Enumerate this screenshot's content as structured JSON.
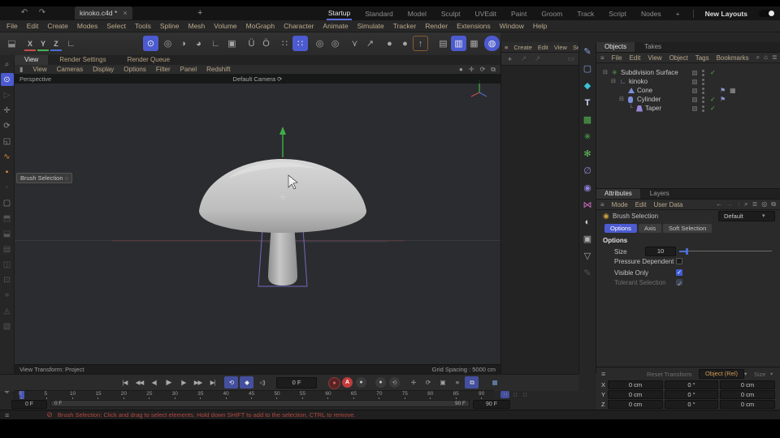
{
  "icons": {
    "undo": "↶",
    "redo": "↷",
    "close": "×",
    "plus": "+",
    "hamburger": "≡",
    "search": "⌕",
    "home": "⌂",
    "filter": "≣",
    "export": "⧉",
    "badge": "◎",
    "arrow_left": "←",
    "arrow_right": "→",
    "arrow_up": "↑",
    "chevron_down": "▾",
    "chevron_right": "›",
    "check": "✓",
    "flag": "⚑",
    "checker": "▦",
    "loop": "⟲",
    "keyframe": "◆",
    "speaker": "◁)",
    "record": "●",
    "autokey": "A",
    "move": "✛",
    "rotate": "⟳",
    "scale": "◱",
    "magnify": "⌕",
    "live_select": "⊙",
    "play_dim": "▷",
    "point": "∿",
    "edge": "▪",
    "polygon": "▫",
    "model": "▢",
    "gem": "◈",
    "snap": "Ü",
    "quantize": "Ö",
    "grid": "∷",
    "target": "◎",
    "bird": "⋎",
    "arrow_ne": "↗",
    "circle": "●",
    "axis_up": "↑",
    "corner": "∟",
    "pen": "✎",
    "square": "▢",
    "cube": "◆",
    "text_t": "T",
    "subd": "▩",
    "clover": "✳",
    "flower": "✻",
    "field": "∅",
    "mograph": "◉",
    "volume": "⋈",
    "env": "◐",
    "camera": "▣",
    "light": "▽",
    "trash": "▭",
    "chart": "▦",
    "bar": "▮",
    "dot_tool": "◌",
    "refresh": "⟳"
  },
  "titlebar": {
    "document_tab": "kinoko.c4d *",
    "layout_tabs": [
      "Startup",
      "Standard",
      "Model",
      "Sculpt",
      "UVEdit",
      "Paint",
      "Groom",
      "Track",
      "Script",
      "Nodes"
    ],
    "new_layouts_label": "New Layouts"
  },
  "menubar": {
    "items": [
      "File",
      "Edit",
      "Create",
      "Modes",
      "Select",
      "Tools",
      "Spline",
      "Mesh",
      "Volume",
      "MoGraph",
      "Character",
      "Animate",
      "Simulate",
      "Tracker",
      "Render",
      "Extensions",
      "Window",
      "Help"
    ]
  },
  "toolbar": {
    "axis_x": "X",
    "axis_y": "Y",
    "axis_z": "Z"
  },
  "viewport": {
    "tabs": [
      "View",
      "Render Settings",
      "Render Queue"
    ],
    "menu": [
      "View",
      "Cameras",
      "Display",
      "Options",
      "Filter",
      "Panel",
      "Redshift"
    ],
    "projection_label": "Perspective",
    "camera_label": "Default Camera",
    "tool_hint": "Brush Selection",
    "view_transform": "View Transform: Project",
    "grid_spacing": "Grid Spacing : 5000 cm"
  },
  "mid_panel": {
    "menu": [
      "Create",
      "Edit",
      "View",
      "Select"
    ]
  },
  "object_manager": {
    "tabs": [
      "Objects",
      "Takes"
    ],
    "menu": [
      "File",
      "Edit",
      "View",
      "Object",
      "Tags",
      "Bookmarks"
    ],
    "tree": [
      {
        "name": "Subdivision Surface"
      },
      {
        "name": "kinoko"
      },
      {
        "name": "Cone"
      },
      {
        "name": "Cylinder"
      },
      {
        "name": "Taper"
      }
    ]
  },
  "attributes": {
    "tabs": [
      "Attributes",
      "Layers"
    ],
    "menu": [
      "Mode",
      "Edit",
      "User Data"
    ],
    "object_title": "Brush Selection",
    "preset_label": "Default",
    "section_tabs": [
      "Options",
      "Axis",
      "Soft Selection"
    ],
    "section_header": "Options",
    "fields": {
      "size_label": "Size",
      "size_value": "10",
      "pressure_label": "Pressure Dependent",
      "visible_label": "Visible Only",
      "tolerant_label": "Tolerant Selection"
    }
  },
  "coordinates": {
    "reset_label": "Reset Transform",
    "mode_label": "Object (Rel)",
    "size_label": "Size",
    "rows": [
      {
        "axis": "X",
        "pos": "0 cm",
        "rot": "0 °",
        "scale": "0 cm"
      },
      {
        "axis": "Y",
        "pos": "0 cm",
        "rot": "0 °",
        "scale": "0 cm"
      },
      {
        "axis": "Z",
        "pos": "0 cm",
        "rot": "0 °",
        "scale": "0 cm"
      }
    ]
  },
  "timeline": {
    "transport": [
      "|◀",
      "◀◀",
      "◀|",
      "▶",
      "|▶",
      "▶▶",
      "▶|"
    ],
    "current_frame": "0 F",
    "range_start": "0 F",
    "range_end": "90 F",
    "start_field": "0 F",
    "end_field": "90 F",
    "ticks": [
      0,
      5,
      10,
      15,
      20,
      25,
      30,
      35,
      40,
      45,
      50,
      55,
      60,
      65,
      70,
      75,
      80,
      85,
      90
    ],
    "max": 90
  },
  "statusbar": {
    "message": "Brush Selection: Click and drag to select elements. Hold down SHIFT to add to the selection, CTRL to remove."
  }
}
